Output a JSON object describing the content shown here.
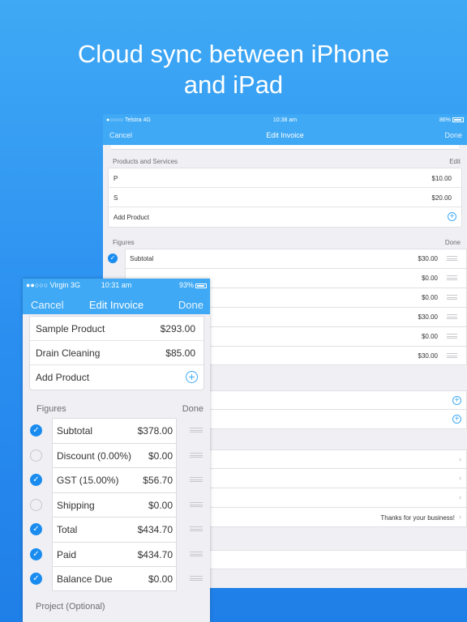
{
  "headline": {
    "line1": "Cloud sync between iPhone",
    "line2": "and iPad"
  },
  "ipad": {
    "status": {
      "carrier": "●○○○○ Telstra  4G",
      "time": "10:38 am",
      "battery": "86%"
    },
    "nav": {
      "left": "Cancel",
      "title": "Edit Invoice",
      "right": "Done"
    },
    "products_header": {
      "label": "Products and Services",
      "action": "Edit"
    },
    "products": [
      {
        "name": "P",
        "price": "$10.00"
      },
      {
        "name": "S",
        "price": "$20.00"
      }
    ],
    "add_product": "Add Product",
    "figures_header": {
      "label": "Figures",
      "action": "Done"
    },
    "figures": [
      {
        "name": "Subtotal",
        "value": "$30.00"
      },
      {
        "name": "",
        "value": "$0.00"
      },
      {
        "name": "",
        "value": "$0.00"
      },
      {
        "name": "",
        "value": "$30.00"
      },
      {
        "name": "",
        "value": "$0.00"
      },
      {
        "name": "",
        "value": "$30.00"
      }
    ],
    "notes_value": "Thanks for your business!"
  },
  "iphone": {
    "status": {
      "carrier": "●●○○○ Virgin  3G",
      "time": "10:31 am",
      "battery": "93%"
    },
    "nav": {
      "left": "Cancel",
      "title": "Edit Invoice",
      "right": "Done"
    },
    "products": [
      {
        "name": "Sample Product",
        "price": "$293.00"
      },
      {
        "name": "Drain Cleaning",
        "price": "$85.00"
      }
    ],
    "add_product": "Add Product",
    "figures_header": {
      "label": "Figures",
      "action": "Done"
    },
    "figures": [
      {
        "name": "Subtotal",
        "value": "$378.00",
        "checked": true
      },
      {
        "name": "Discount (0.00%)",
        "value": "$0.00",
        "checked": false
      },
      {
        "name": "GST (15.00%)",
        "value": "$56.70",
        "checked": true
      },
      {
        "name": "Shipping",
        "value": "$0.00",
        "checked": false
      },
      {
        "name": "Total",
        "value": "$434.70",
        "checked": true
      },
      {
        "name": "Paid",
        "value": "$434.70",
        "checked": true
      },
      {
        "name": "Balance Due",
        "value": "$0.00",
        "checked": true
      }
    ],
    "project_header": "Project (Optional)"
  },
  "colors": {
    "accent": "#3fa9f5",
    "check": "#1a8cf0",
    "background": "#efeff4"
  }
}
